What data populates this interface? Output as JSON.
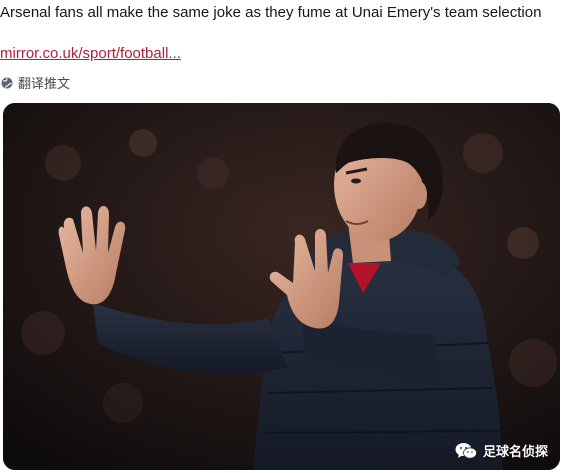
{
  "tweet": {
    "headline": "Arsenal fans all make the same joke as they fume at Unai Emery's team selection",
    "link_text": "mirror.co.uk/sport/football...",
    "translate_label": "翻译推文"
  },
  "media": {
    "watermark_text": "足球名侦探",
    "watermark_icon": "wechat-icon"
  },
  "colors": {
    "link": "#b0203a",
    "text": "#14171a",
    "photo_bg": "#1a1414"
  }
}
